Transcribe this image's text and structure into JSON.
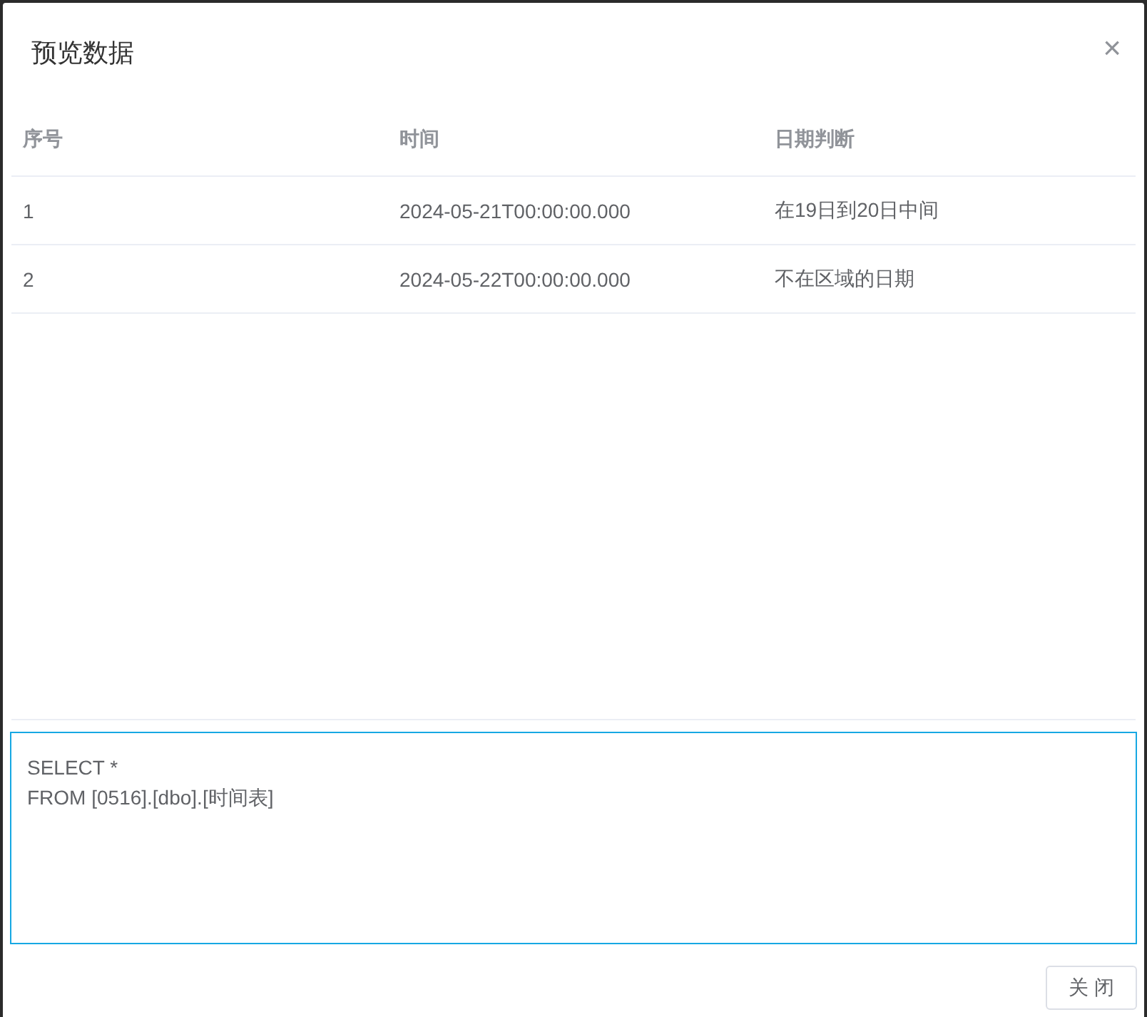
{
  "dialog": {
    "title": "预览数据",
    "close_icon": "×"
  },
  "table": {
    "columns": [
      "序号",
      "时间",
      "日期判断"
    ],
    "rows": [
      [
        "1",
        "2024-05-21T00:00:00.000",
        "在19日到20日中间"
      ],
      [
        "2",
        "2024-05-22T00:00:00.000",
        "不在区域的日期"
      ]
    ]
  },
  "sql_editor": {
    "value": "SELECT *\nFROM [0516].[dbo].[时间表]"
  },
  "buttons": [
    "关 闭"
  ]
}
